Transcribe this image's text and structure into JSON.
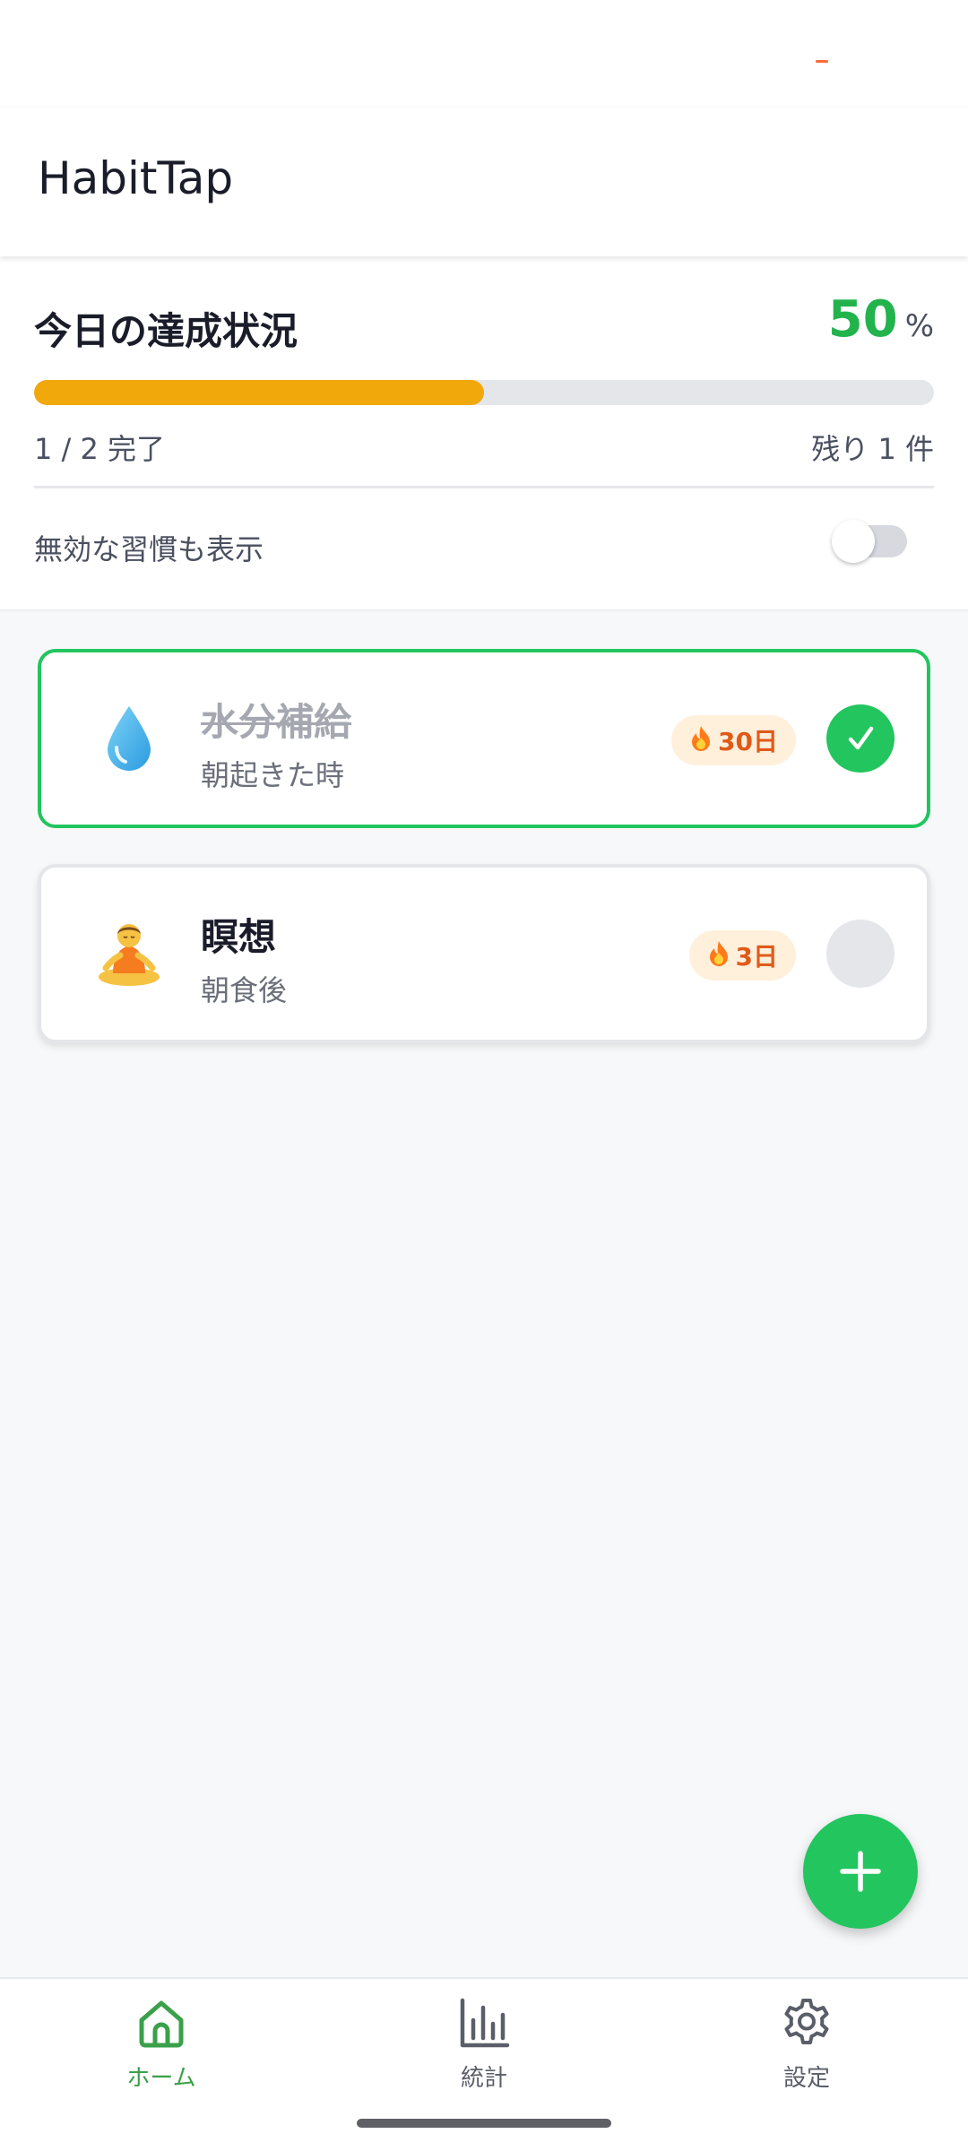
{
  "app": {
    "title": "HabitTap"
  },
  "summary": {
    "title": "今日の達成状況",
    "percent": "50",
    "percent_sign": "%",
    "progress_fraction": 0.5,
    "completed_text": "1 / 2 完了",
    "remaining_text": "残り 1 件",
    "toggle_label": "無効な習慣も表示",
    "toggle_on": false
  },
  "habits": [
    {
      "icon": "droplet-icon",
      "name": "水分補給",
      "time": "朝起きた時",
      "streak": "30日",
      "done": true
    },
    {
      "icon": "meditation-icon",
      "name": "瞑想",
      "time": "朝食後",
      "streak": "3日",
      "done": false
    }
  ],
  "nav": {
    "items": [
      {
        "label": "ホーム",
        "icon": "home-icon",
        "active": true
      },
      {
        "label": "統計",
        "icon": "bar-chart-icon",
        "active": false
      },
      {
        "label": "設定",
        "icon": "gear-icon",
        "active": false
      }
    ]
  },
  "colors": {
    "accent_green": "#22c55e",
    "progress_fill": "#f0a80a",
    "streak_bg": "#fff0dc",
    "streak_text": "#e05a1a"
  }
}
